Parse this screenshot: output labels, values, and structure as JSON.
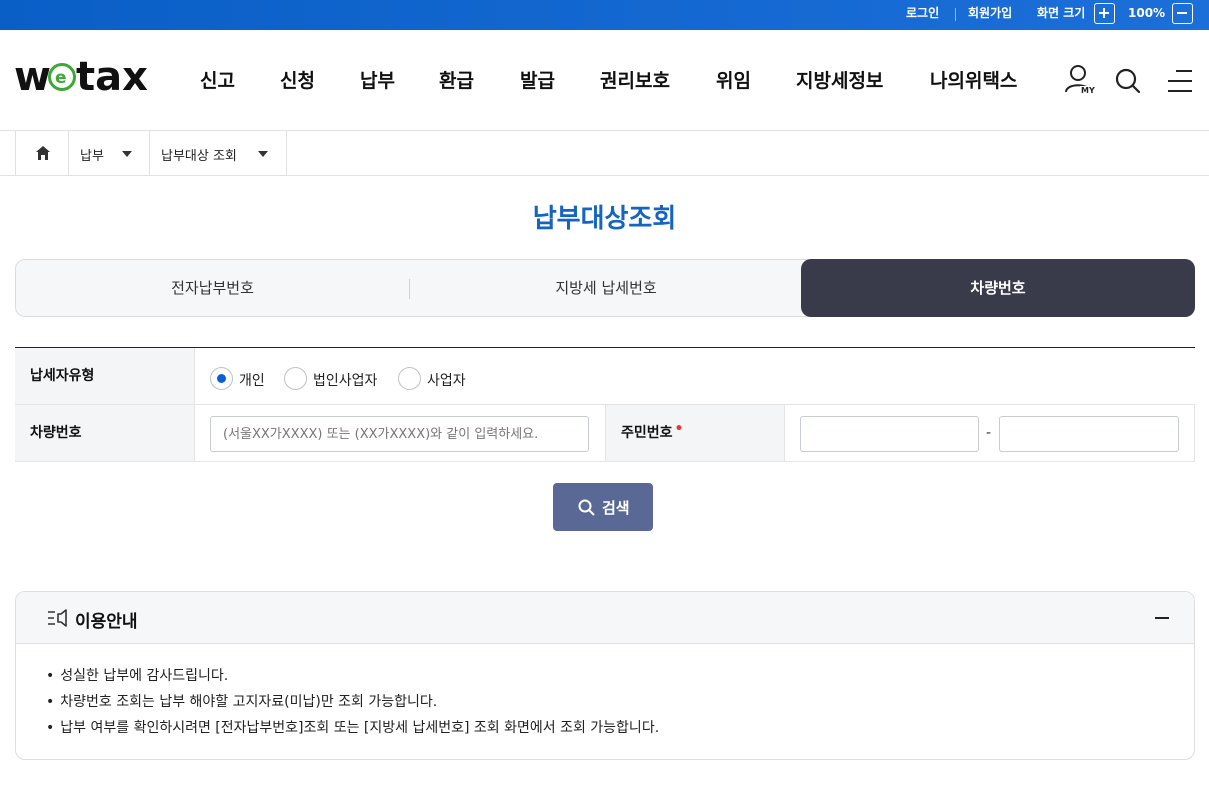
{
  "topbar": {
    "login": "로그인",
    "signup": "회원가입",
    "zoom_label": "화면 크기",
    "zoom_level": "100%"
  },
  "header": {
    "logo": "wetax",
    "nav": [
      "신고",
      "신청",
      "납부",
      "환급",
      "발급",
      "권리보호",
      "위임",
      "지방세정보",
      "나의위택스"
    ],
    "my_label": "MY"
  },
  "breadcrumb": {
    "level1": "납부",
    "level2": "납부대상 조회"
  },
  "page": {
    "title": "납부대상조회"
  },
  "tabs": [
    {
      "label": "전자납부번호",
      "active": false
    },
    {
      "label": "지방세 납세번호",
      "active": false
    },
    {
      "label": "차량번호",
      "active": true
    }
  ],
  "form": {
    "taxpayer_type_label": "납세자유형",
    "taxpayer_types": [
      "개인",
      "법인사업자",
      "사업자"
    ],
    "taxpayer_type_selected": "개인",
    "vehicle_label": "차량번호",
    "vehicle_placeholder": "(서울XX가XXXX) 또는 (XX가XXXX)와 같이 입력하세요.",
    "resident_label": "주민번호",
    "resident_required_mark": "•",
    "resident_separator": "-",
    "search_label": "검색"
  },
  "info": {
    "title": "이용안내",
    "items": [
      "성실한 납부에 감사드립니다.",
      "차량번호 조회는 납부 해야할 고지자료(미납)만 조회 가능합니다.",
      "납부 여부를 확인하시려면 [전자납부번호]조회 또는 [지방세 납세번호] 조회 화면에서 조회 가능합니다."
    ]
  },
  "colors": {
    "brand_blue": "#1565c0",
    "active_tab": "#393b4b",
    "search_button": "#5a6896",
    "radio_on": "#0b5fd4",
    "required": "#e53935",
    "logo_green": "#3aa935"
  }
}
